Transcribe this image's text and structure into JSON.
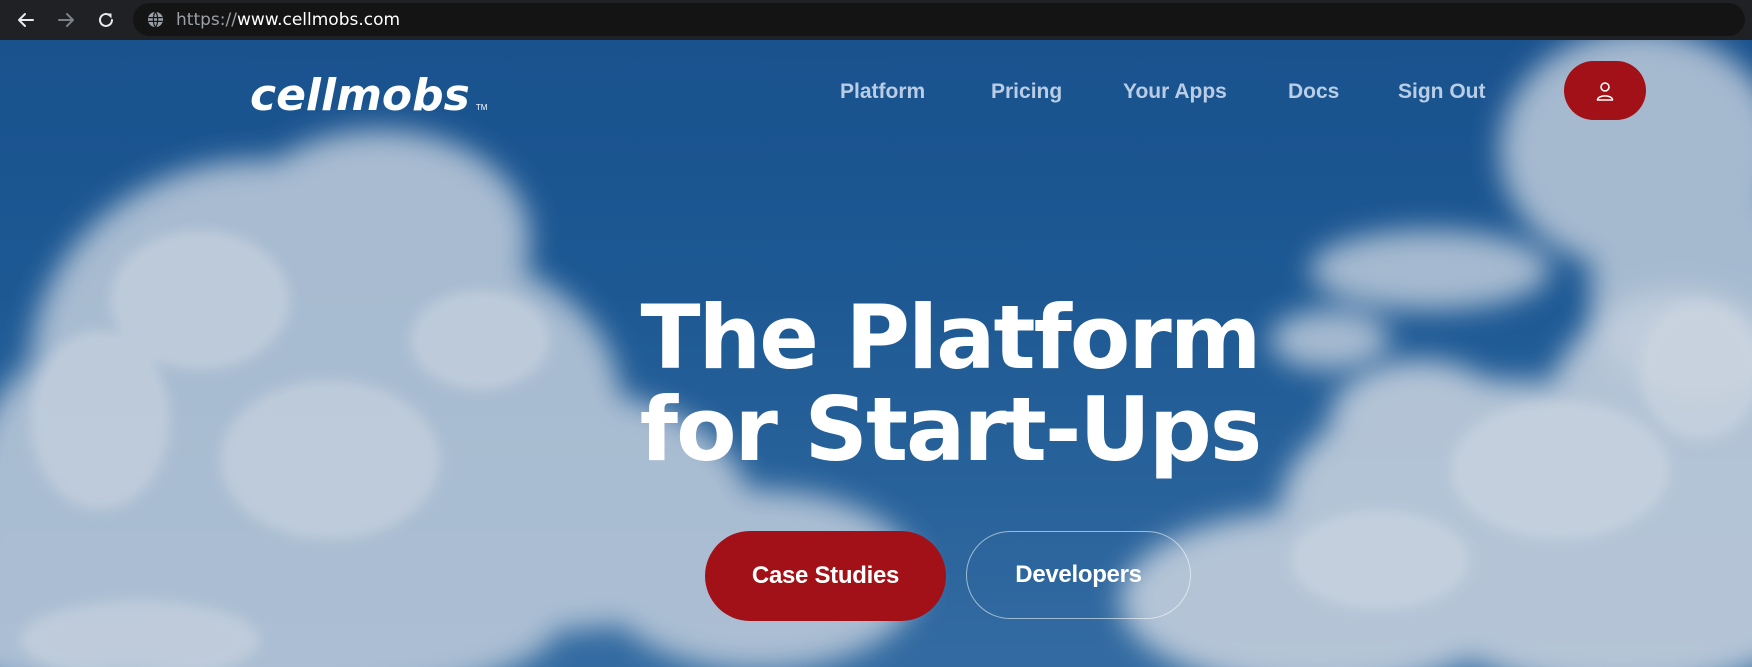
{
  "browser": {
    "url_scheme": "https://",
    "url_host": "www.cellmobs.com",
    "back_icon": "arrow-left-icon",
    "forward_icon": "arrow-right-icon",
    "reload_icon": "reload-icon",
    "site_icon": "globe-icon"
  },
  "header": {
    "logo_text": "cellmobs",
    "logo_tm": "TM",
    "nav": {
      "platform": "Platform",
      "pricing": "Pricing",
      "your_apps": "Your Apps",
      "docs": "Docs",
      "sign_out": "Sign Out"
    },
    "user_icon": "user-icon"
  },
  "hero": {
    "headline_line1": "The Platform",
    "headline_line2": "for Start-Ups",
    "primary_cta": "Case Studies",
    "secondary_cta": "Developers"
  },
  "colors": {
    "accent": "#a11117",
    "sky": "#1f5a96",
    "nav_text": "#b9cde6"
  }
}
